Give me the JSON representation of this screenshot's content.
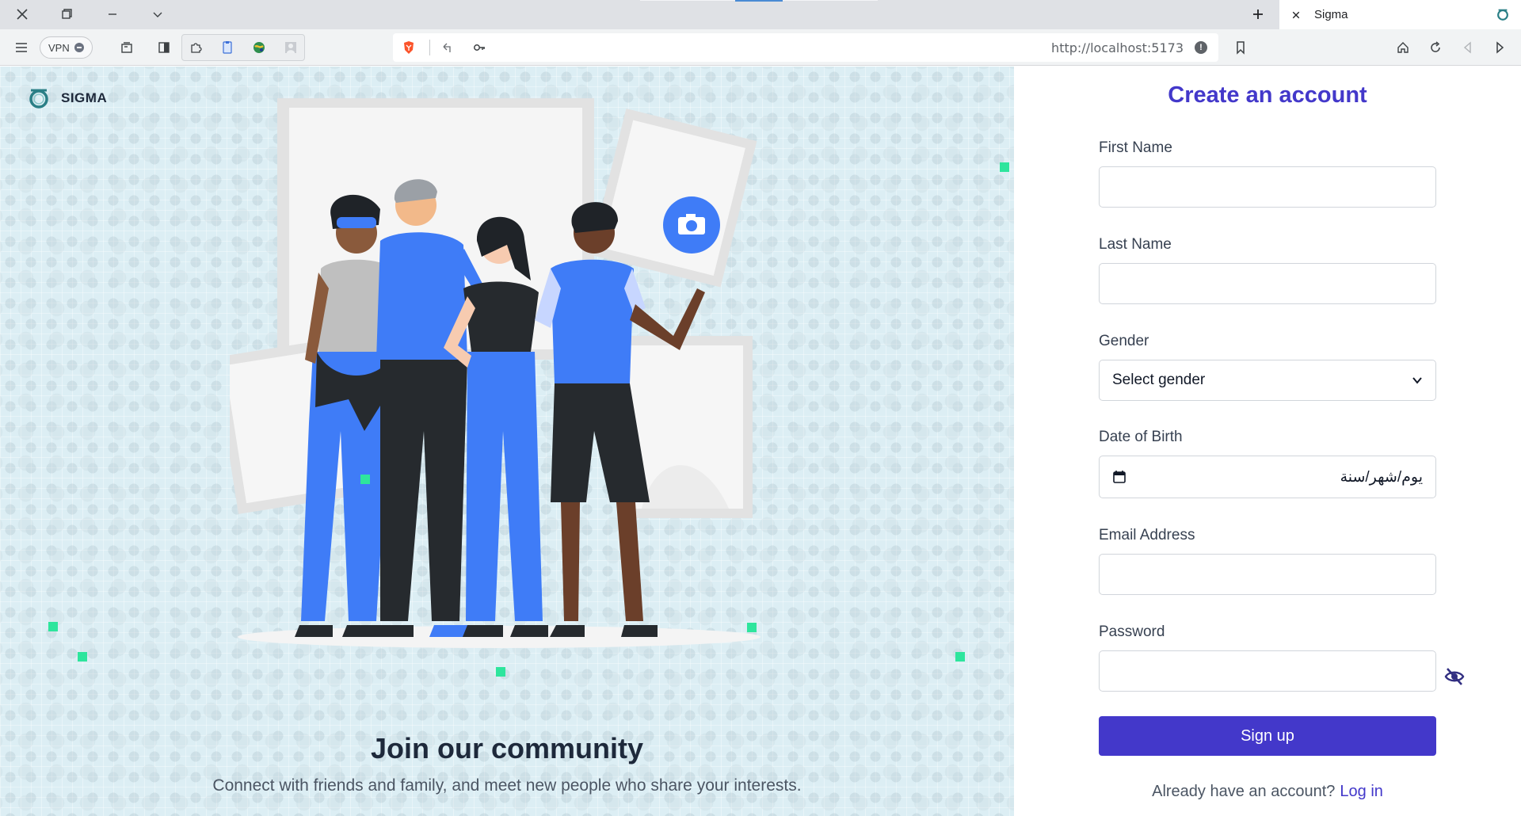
{
  "browser": {
    "tab_title": "Sigma",
    "vpn_label": "VPN",
    "url": "http://localhost:5173",
    "url_info_glyph": "!"
  },
  "brand": {
    "name": "SIGMA",
    "accent": "#2a7f86"
  },
  "hero": {
    "title": "Join our community",
    "subtitle": "Connect with friends and family, and meet new people who share your interests."
  },
  "form": {
    "title": "Create an account",
    "first_name_label": "First Name",
    "first_name_value": "",
    "last_name_label": "Last Name",
    "last_name_value": "",
    "gender_label": "Gender",
    "gender_selected": "Select gender",
    "dob_label": "Date of Birth",
    "dob_placeholder": "يوم/شهر/سنة",
    "email_label": "Email Address",
    "email_value": "",
    "password_label": "Password",
    "password_value": "",
    "signup_label": "Sign up",
    "login_prompt": "Already have an account?",
    "login_link": "Log in"
  },
  "colors": {
    "primary": "#4338ca",
    "hero_bg": "#dceef4",
    "accent_squares": "#2ee59d",
    "person_blue": "#3f7cf7"
  },
  "icons": [
    "close-icon",
    "restore-icon",
    "minimize-icon",
    "chevron-down-icon",
    "new-tab-icon",
    "menu-icon",
    "brave-shield-icon",
    "key-icon",
    "bookmark-icon",
    "home-icon",
    "reload-icon",
    "back-icon",
    "forward-icon",
    "calendar-icon",
    "eye-off-icon",
    "camera-icon"
  ]
}
